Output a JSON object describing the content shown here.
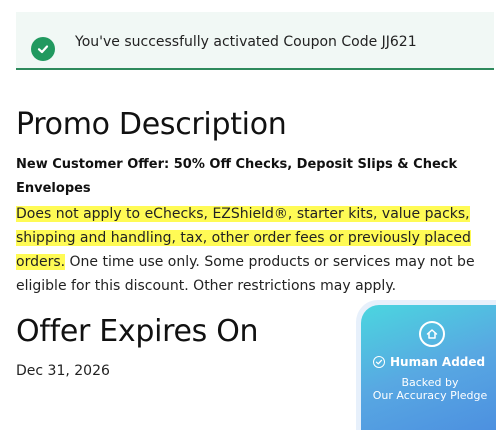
{
  "alert": {
    "message": "You've successfully activated Coupon Code JJ621",
    "icon": "check-circle-icon",
    "accent_color": "#21995f"
  },
  "promo": {
    "title": "Promo Description",
    "offer_heading": "New Customer Offer: 50% Off Checks, Deposit Slips & Check Envelopes",
    "highlighted_text": "Does not apply to eChecks, EZShield®, starter kits, value packs, shipping and handling, tax, other order fees or previously placed orders.",
    "plain_text": " One time use only. Some products or services may not be eligible for this discount. Other restrictions may apply.",
    "highlight_color": "#fffb55"
  },
  "expiry": {
    "title": "Offer Expires On",
    "date": "Dec 31, 2026"
  },
  "badge": {
    "icon": "shield-home-icon",
    "title": "Human Added",
    "subtitle_line1": "Backed by",
    "subtitle_line2": "Our Accuracy Pledge"
  }
}
